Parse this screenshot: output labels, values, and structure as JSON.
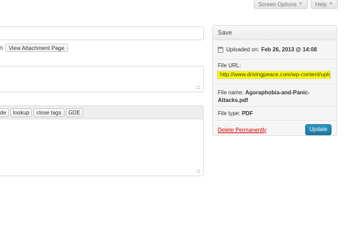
{
  "screen_meta": {
    "screen_options_label": "Screen Options",
    "help_label": "Help",
    "arrow": "▼"
  },
  "editor": {
    "permalink_fragment": "6",
    "view_attachment_label": "View Attachment Page",
    "quicktags": [
      "de",
      "lookup",
      "close tags",
      "GDE"
    ]
  },
  "save_box": {
    "title": "Save",
    "uploaded_label": "Uploaded on:",
    "uploaded_value": "Feb 26, 2013 @ 14:08",
    "file_url_label": "File URL:",
    "file_url_value": "http://www.drivingpeace.com/wp-content/uploa",
    "file_name_label": "File name:",
    "file_name_value": "Agoraphobia-and-Panic-Attacks.pdf",
    "file_type_label": "File type:",
    "file_type_value": "PDF",
    "delete_label": "Delete Permanently",
    "update_label": "Update"
  },
  "colors": {
    "highlight": "#ffff00",
    "delete_link": "#d20000",
    "primary_button": "#21759b"
  }
}
